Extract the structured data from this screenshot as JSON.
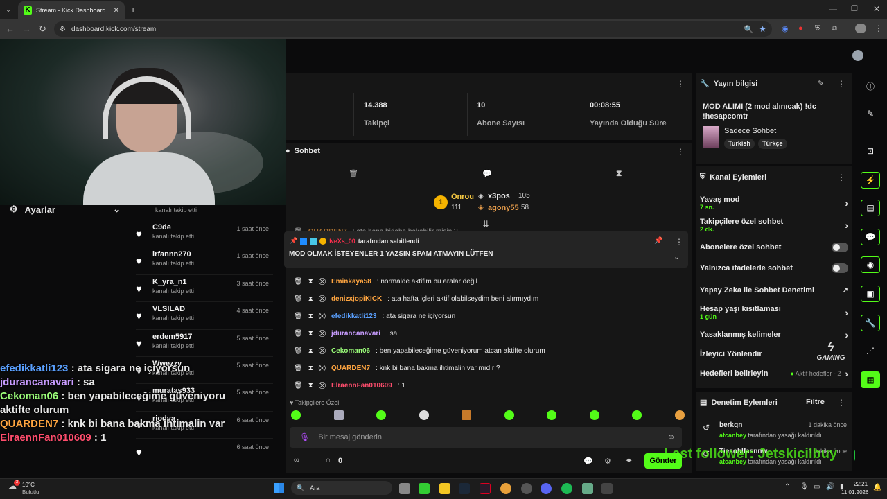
{
  "browser": {
    "tab_title": "Stream - Kick Dashboard",
    "url": "dashboard.kick.com/stream"
  },
  "stats": [
    {
      "value": "14.388",
      "label": "Takipçi"
    },
    {
      "value": "10",
      "label": "Abone Sayısı"
    },
    {
      "value": "00:08:55",
      "label": "Yayında Olduğu Süre"
    }
  ],
  "settings_label": "Ayarlar",
  "followers": {
    "first_sub": "kanalı takip etti",
    "items": [
      {
        "name": "C9de",
        "sub": "kanalı takip etti",
        "time": "1 saat önce"
      },
      {
        "name": "irfannn270",
        "sub": "kanalı takip etti",
        "time": "1 saat önce"
      },
      {
        "name": "K_yra_n1",
        "sub": "kanalı takip etti",
        "time": "3 saat önce"
      },
      {
        "name": "VLSILAD",
        "sub": "kanalı takip etti",
        "time": "4 saat önce"
      },
      {
        "name": "erdem5917",
        "sub": "kanalı takip etti",
        "time": "5 saat önce"
      },
      {
        "name": "Wwezzy",
        "sub": "kanalı takip etti",
        "time": "5 saat önce"
      },
      {
        "name": "muratas933",
        "sub": "kanalı takip etti",
        "time": "5 saat önce"
      },
      {
        "name": "riodva",
        "sub": "kanalı takip etti",
        "time": "6 saat önce"
      },
      {
        "name": "",
        "sub": "",
        "time": "6 saat önce"
      }
    ]
  },
  "overlay_chat": [
    {
      "user": "efedikkatli123",
      "text": " : ata sigara ne içiyorsun",
      "color": "#5aa0ff"
    },
    {
      "user": "jdurancanavari",
      "text": " : sa",
      "color": "#c89cff"
    },
    {
      "user": "Cekoman06",
      "text": " : ben yapabileceğime güveniyoru",
      "color": "#9cff7a"
    },
    {
      "user": "",
      "text": "aktifte olurum",
      "color": "#ffffff"
    },
    {
      "user": "QUARDEN7",
      "text": " : knk bi bana bakma ihtimalin var",
      "color": "#ffa540"
    },
    {
      "user": "ElraennFan010609",
      "text": " : 1",
      "color": "#ff4d6d"
    }
  ],
  "chat": {
    "title": "Sohbet",
    "leaderboard": {
      "first": {
        "rank": "1",
        "name": "Onrou",
        "count": "111"
      },
      "second": {
        "name": "x3pos",
        "count": "105"
      },
      "third": {
        "name": "agony55",
        "count": "58"
      }
    },
    "partial_msg": {
      "user": "QUARDEN7",
      "text": ": ata bana bidaha bakabilir misin ?"
    },
    "pinned": {
      "by_user": "NeXs_00",
      "by_text": "tarafından sabitlendi",
      "text": "MOD OLMAK İSTEYENLER 1 YAZSIN SPAM ATMAYIN LÜTFEN"
    },
    "messages": [
      {
        "user": "Eminkaya58",
        "text": ": normalde aktifim bu aralar değil",
        "color": "#ffa540"
      },
      {
        "user": "denizxjopiKICK",
        "text": ": ata hafta içleri aktif olabilseydim beni alırmıydım",
        "color": "#ffa540"
      },
      {
        "user": "efedikkatli123",
        "text": ": ata sigara ne içiyorsun",
        "color": "#5aa0ff"
      },
      {
        "user": "jdurancanavari",
        "text": ": sa",
        "color": "#c89cff"
      },
      {
        "user": "Cekoman06",
        "text": ": ben yapabileceğime güveniyorum atcan aktifte olurum",
        "color": "#9cff7a"
      },
      {
        "user": "QUARDEN7",
        "text": ": knk bi bana bakma ihtimalin var mıdır ?",
        "color": "#ffa540"
      },
      {
        "user": "ElraennFan010609",
        "text": ": 1",
        "color": "#ff4d6d"
      }
    ],
    "followers_only_label": "Takipçilere Özel",
    "input_placeholder": "Bir mesaj gönderin",
    "points": "0",
    "send_label": "Gönder"
  },
  "stream_info": {
    "title": "Yayın bilgisi",
    "stream_title": "MOD ALIMI (2 mod alınıcak) !dc !hesapcomtr",
    "category": "Sadece Sohbet",
    "tags": [
      "Turkish",
      "Türkçe"
    ]
  },
  "channel_actions": {
    "title": "Kanal Eylemleri",
    "items": [
      {
        "label": "Yavaş mod",
        "sub": "7 sn.",
        "control": "chevron"
      },
      {
        "label": "Takipçilere özel sohbet",
        "sub": "2 dk.",
        "control": "chevron"
      },
      {
        "label": "Abonelere özel sohbet",
        "sub": "",
        "control": "toggle"
      },
      {
        "label": "Yalnızca ifadelerle sohbet",
        "sub": "",
        "control": "toggle"
      },
      {
        "label": "Yapay Zeka ile Sohbet Denetimi",
        "sub": "",
        "control": "external"
      },
      {
        "label": "Hesap yaşı kısıtlaması",
        "sub": "1 gün",
        "control": "chevron"
      },
      {
        "label": "Yasaklanmış kelimeler",
        "sub": "",
        "control": "chevron"
      },
      {
        "label": "İzleyici Yönlendir",
        "sub": "",
        "control": "none"
      },
      {
        "label": "Hedefleri belirleyin",
        "sub": "",
        "control": "chevron",
        "status": "Aktif hedefler - 2"
      }
    ]
  },
  "moderation": {
    "title": "Denetim Eylemleri",
    "filter_label": "Filtre",
    "items": [
      {
        "user": "berkqn",
        "time": "1 dakika önce",
        "by": "atcanbey",
        "text": "tarafından yasağı kaldırıldı"
      },
      {
        "user": "Tiesoblfasnnw",
        "time": "1 dakika önce",
        "by": "atcanbey",
        "text": "tarafından yasağı kaldırıldı"
      }
    ]
  },
  "watermark": {
    "brand": "GAMING",
    "follower_banner": "Last follower: Jetskicilbuy"
  },
  "taskbar": {
    "weather_temp": "10°C",
    "weather_desc": "Bulutlu",
    "search_label": "Ara",
    "time": "22:21",
    "date": "11.01.2026",
    "weather_badge": "3"
  },
  "colors": {
    "accent": "#53fc18",
    "panel": "#161616",
    "background": "#0b0b0c"
  }
}
